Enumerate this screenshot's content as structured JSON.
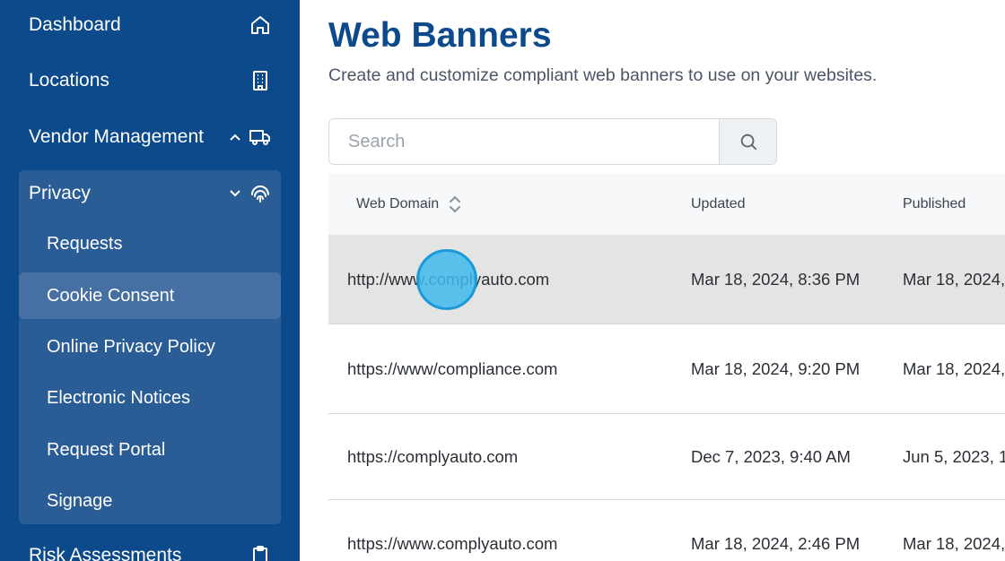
{
  "sidebar": {
    "items": [
      {
        "label": "Dashboard",
        "icon": "home-icon"
      },
      {
        "label": "Locations",
        "icon": "building-icon"
      },
      {
        "label": "Vendor Management",
        "icon": "truck-icon"
      },
      {
        "label": "Privacy",
        "icon": "fingerprint-icon"
      },
      {
        "label": "Risk Assessments",
        "icon": "clipboard-icon"
      }
    ],
    "privacy_sub": [
      {
        "label": "Requests"
      },
      {
        "label": "Cookie Consent",
        "active": true
      },
      {
        "label": "Online Privacy Policy"
      },
      {
        "label": "Electronic Notices"
      },
      {
        "label": "Request Portal"
      },
      {
        "label": "Signage"
      }
    ]
  },
  "main": {
    "title": "Web Banners",
    "subtitle": "Create and customize compliant web banners to use on your websites.",
    "search": {
      "placeholder": "Search"
    }
  },
  "table": {
    "columns": [
      "Web Domain",
      "Updated",
      "Published"
    ],
    "rows": [
      {
        "domain": "http://www.complyauto.com",
        "updated": "Mar 18, 2024, 8:36 PM",
        "published": "Mar 18, 2024,"
      },
      {
        "domain": "https://www/compliance.com",
        "updated": "Mar 18, 2024, 9:20 PM",
        "published": "Mar 18, 2024,"
      },
      {
        "domain": "https://complyauto.com",
        "updated": "Dec 7, 2023, 9:40 AM",
        "published": "Jun 5, 2023, 1"
      },
      {
        "domain": "https://www.complyauto.com",
        "updated": "Mar 18, 2024, 2:46 PM",
        "published": "Mar 18, 2024,"
      }
    ]
  },
  "colors": {
    "sidebar_bg": "#0d4a8c",
    "privacy_group_bg": "#2a5d96",
    "active_item_bg": "#4670a4",
    "title": "#0d4a8c",
    "cursor": "#40baec"
  }
}
